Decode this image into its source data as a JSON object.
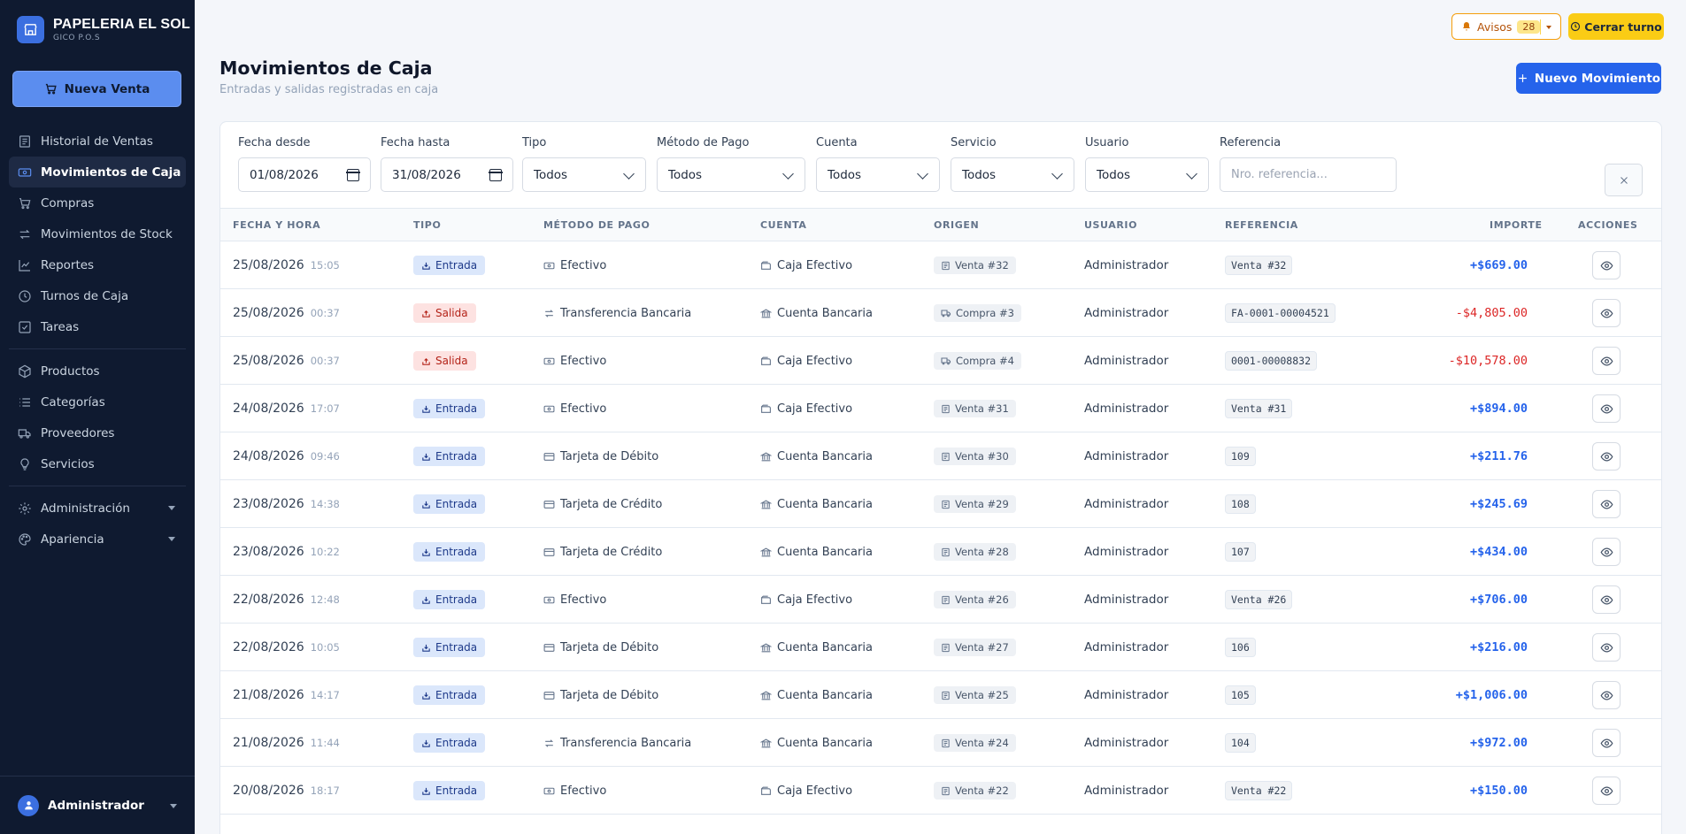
{
  "brand": {
    "name": "PAPELERIA EL SOL",
    "subtitle": "GICO P.O.S"
  },
  "sidebar": {
    "new_sale_label": "Nueva Venta",
    "items": [
      {
        "label": "Historial de Ventas",
        "icon": "receipt-icon"
      },
      {
        "label": "Movimientos de Caja",
        "icon": "cash-icon",
        "active": true
      },
      {
        "label": "Compras",
        "icon": "cart-icon"
      },
      {
        "label": "Movimientos de Stock",
        "icon": "transfer-icon"
      },
      {
        "label": "Reportes",
        "icon": "chart-icon"
      },
      {
        "label": "Turnos de Caja",
        "icon": "clock-icon"
      },
      {
        "label": "Tareas",
        "icon": "checkbox-icon"
      },
      {
        "label": "Productos",
        "icon": "box-icon"
      },
      {
        "label": "Categorías",
        "icon": "list-icon"
      },
      {
        "label": "Proveedores",
        "icon": "truck-icon"
      },
      {
        "label": "Servicios",
        "icon": "bulb-icon"
      },
      {
        "label": "Administración",
        "icon": "gear-icon"
      },
      {
        "label": "Apariencia",
        "icon": "palette-icon"
      }
    ],
    "user_name": "Administrador"
  },
  "topbar": {
    "avisos_label": "Avisos",
    "avisos_count": "28",
    "cerrar_turno_label": "Cerrar turno"
  },
  "page": {
    "title": "Movimientos de Caja",
    "subtitle": "Entradas y salidas registradas en caja",
    "new_button_label": "Nuevo Movimiento"
  },
  "filters": {
    "fecha_desde": {
      "label": "Fecha desde",
      "value": "01/08/2026"
    },
    "fecha_hasta": {
      "label": "Fecha hasta",
      "value": "31/08/2026"
    },
    "tipo": {
      "label": "Tipo",
      "value": "Todos"
    },
    "metodo": {
      "label": "Método de Pago",
      "value": "Todos"
    },
    "cuenta": {
      "label": "Cuenta",
      "value": "Todos"
    },
    "servicio": {
      "label": "Servicio",
      "value": "Todos"
    },
    "usuario": {
      "label": "Usuario",
      "value": "Todos"
    },
    "referencia": {
      "label": "Referencia",
      "placeholder": "Nro. referencia..."
    }
  },
  "table": {
    "headers": {
      "fecha": "FECHA Y HORA",
      "tipo": "TIPO",
      "metodo": "MÉTODO DE PAGO",
      "cuenta": "CUENTA",
      "origen": "ORIGEN",
      "usuario": "USUARIO",
      "referencia": "REFERENCIA",
      "importe": "IMPORTE",
      "acciones": "ACCIONES"
    },
    "rows": [
      {
        "date": "25/08/2026",
        "time": "15:05",
        "type": "Entrada",
        "method": "Efectivo",
        "account": "Caja Efectivo",
        "origin": "Venta #32",
        "user": "Administrador",
        "ref": "Venta #32",
        "amount": "+$669.00"
      },
      {
        "date": "25/08/2026",
        "time": "00:37",
        "type": "Salida",
        "method": "Transferencia Bancaria",
        "account": "Cuenta Bancaria",
        "origin": "Compra #3",
        "user": "Administrador",
        "ref": "FA-0001-00004521",
        "amount": "-$4,805.00"
      },
      {
        "date": "25/08/2026",
        "time": "00:37",
        "type": "Salida",
        "method": "Efectivo",
        "account": "Caja Efectivo",
        "origin": "Compra #4",
        "user": "Administrador",
        "ref": "0001-00008832",
        "amount": "-$10,578.00"
      },
      {
        "date": "24/08/2026",
        "time": "17:07",
        "type": "Entrada",
        "method": "Efectivo",
        "account": "Caja Efectivo",
        "origin": "Venta #31",
        "user": "Administrador",
        "ref": "Venta #31",
        "amount": "+$894.00"
      },
      {
        "date": "24/08/2026",
        "time": "09:46",
        "type": "Entrada",
        "method": "Tarjeta de Débito",
        "account": "Cuenta Bancaria",
        "origin": "Venta #30",
        "user": "Administrador",
        "ref": "109",
        "amount": "+$211.76"
      },
      {
        "date": "23/08/2026",
        "time": "14:38",
        "type": "Entrada",
        "method": "Tarjeta de Crédito",
        "account": "Cuenta Bancaria",
        "origin": "Venta #29",
        "user": "Administrador",
        "ref": "108",
        "amount": "+$245.69"
      },
      {
        "date": "23/08/2026",
        "time": "10:22",
        "type": "Entrada",
        "method": "Tarjeta de Crédito",
        "account": "Cuenta Bancaria",
        "origin": "Venta #28",
        "user": "Administrador",
        "ref": "107",
        "amount": "+$434.00"
      },
      {
        "date": "22/08/2026",
        "time": "12:48",
        "type": "Entrada",
        "method": "Efectivo",
        "account": "Caja Efectivo",
        "origin": "Venta #26",
        "user": "Administrador",
        "ref": "Venta #26",
        "amount": "+$706.00"
      },
      {
        "date": "22/08/2026",
        "time": "10:05",
        "type": "Entrada",
        "method": "Tarjeta de Débito",
        "account": "Cuenta Bancaria",
        "origin": "Venta #27",
        "user": "Administrador",
        "ref": "106",
        "amount": "+$216.00"
      },
      {
        "date": "21/08/2026",
        "time": "14:17",
        "type": "Entrada",
        "method": "Tarjeta de Débito",
        "account": "Cuenta Bancaria",
        "origin": "Venta #25",
        "user": "Administrador",
        "ref": "105",
        "amount": "+$1,006.00"
      },
      {
        "date": "21/08/2026",
        "time": "11:44",
        "type": "Entrada",
        "method": "Transferencia Bancaria",
        "account": "Cuenta Bancaria",
        "origin": "Venta #24",
        "user": "Administrador",
        "ref": "104",
        "amount": "+$972.00"
      },
      {
        "date": "20/08/2026",
        "time": "18:17",
        "type": "Entrada",
        "method": "Efectivo",
        "account": "Caja Efectivo",
        "origin": "Venta #22",
        "user": "Administrador",
        "ref": "Venta #22",
        "amount": "+$150.00"
      }
    ]
  },
  "colors": {
    "sidebar_bg": "#0f1a30",
    "accent": "#2563eb",
    "income": "#2563eb",
    "expense": "#dc2626",
    "warning": "#facc15"
  }
}
